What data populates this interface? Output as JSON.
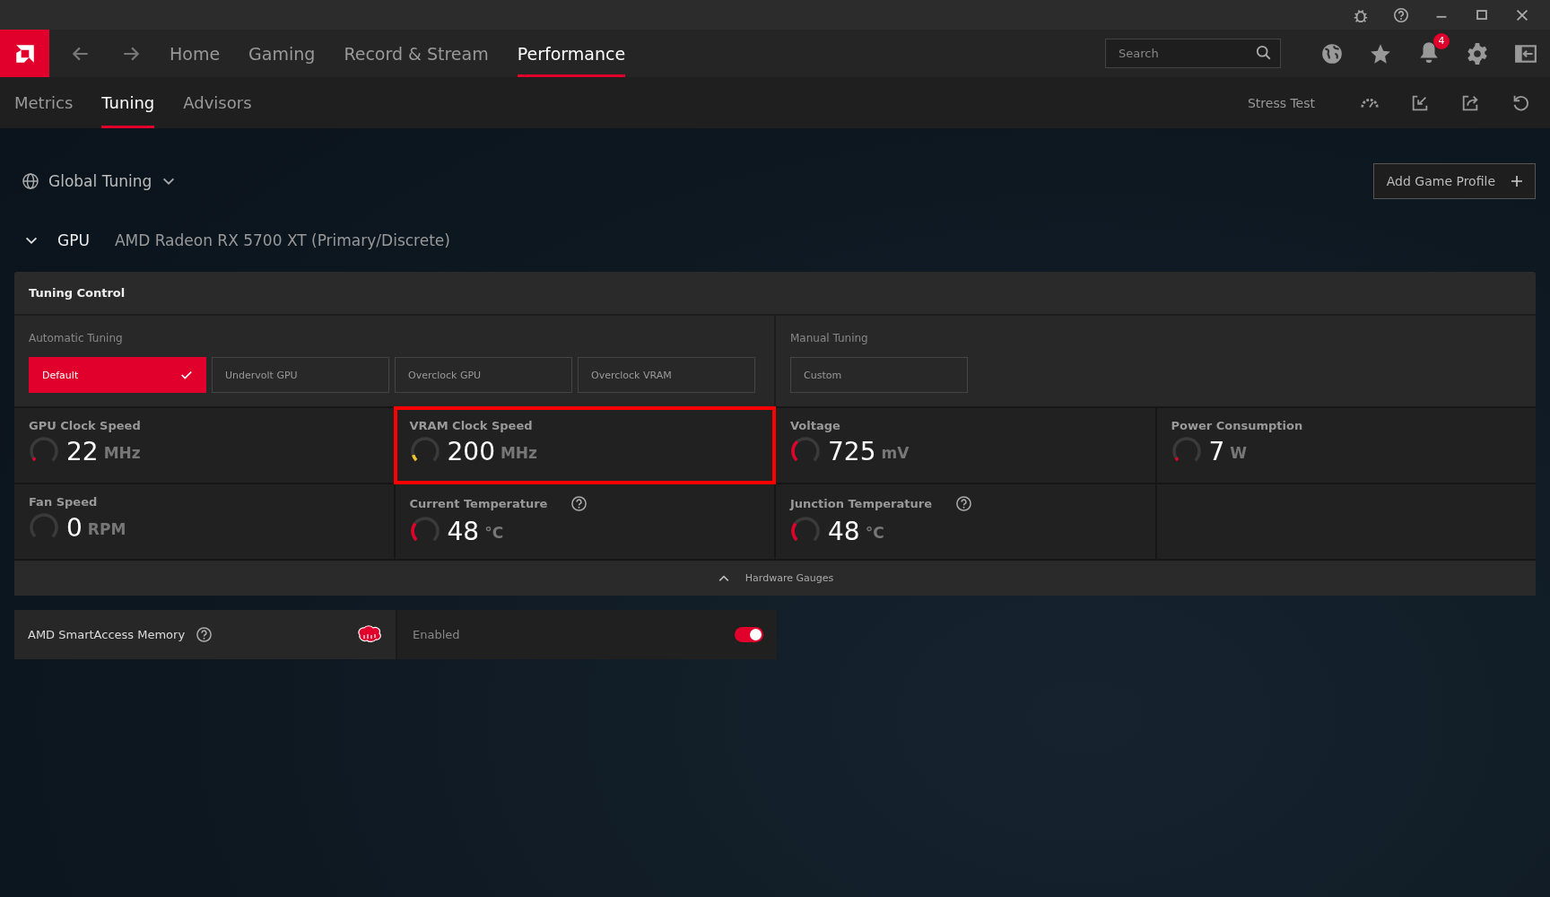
{
  "nav": {
    "tabs": [
      {
        "label": "Home",
        "selected": false
      },
      {
        "label": "Gaming",
        "selected": false
      },
      {
        "label": "Record & Stream",
        "selected": false
      },
      {
        "label": "Performance",
        "selected": true
      }
    ],
    "search": {
      "placeholder": "Search"
    },
    "notification_count": "4"
  },
  "subnav": {
    "tabs": [
      {
        "label": "Metrics",
        "selected": false
      },
      {
        "label": "Tuning",
        "selected": true
      },
      {
        "label": "Advisors",
        "selected": false
      }
    ],
    "stress_test": "Stress Test"
  },
  "profile": {
    "label": "Global Tuning",
    "add_button": "Add Game Profile"
  },
  "gpu": {
    "label": "GPU",
    "name": "AMD Radeon RX 5700 XT (Primary/Discrete)",
    "expanded": true
  },
  "tuning_control": {
    "title": "Tuning Control",
    "automatic": {
      "label": "Automatic Tuning",
      "options": [
        {
          "label": "Default",
          "selected": true
        },
        {
          "label": "Undervolt GPU",
          "selected": false
        },
        {
          "label": "Overclock GPU",
          "selected": false
        },
        {
          "label": "Overclock VRAM",
          "selected": false
        }
      ]
    },
    "manual": {
      "label": "Manual Tuning",
      "options": [
        {
          "label": "Custom",
          "selected": false
        }
      ]
    },
    "metrics": [
      {
        "label": "GPU Clock Speed",
        "value": "22",
        "unit": "MHz",
        "level": 0.05,
        "color": "#e0002b",
        "help": false,
        "highlighted": false
      },
      {
        "label": "VRAM Clock Speed",
        "value": "200",
        "unit": "MHz",
        "level": 0.1,
        "color": "#f2c12e",
        "help": false,
        "highlighted": true
      },
      {
        "label": "Voltage",
        "value": "725",
        "unit": "mV",
        "level": 0.35,
        "color": "#e0002b",
        "help": false,
        "highlighted": false
      },
      {
        "label": "Power Consumption",
        "value": "7",
        "unit": "W",
        "level": 0.05,
        "color": "#e0002b",
        "help": false,
        "highlighted": false
      },
      {
        "label": "Fan Speed",
        "value": "0",
        "unit": "RPM",
        "level": 0,
        "help": false,
        "highlighted": false
      },
      {
        "label": "Current Temperature",
        "value": "48",
        "unit": "°C",
        "level": 0.3,
        "color": "#e0002b",
        "help": true,
        "highlighted": false
      },
      {
        "label": "Junction Temperature",
        "value": "48",
        "unit": "°C",
        "level": 0.3,
        "color": "#e0002b",
        "help": true,
        "highlighted": false
      }
    ],
    "footer": "Hardware Gauges"
  },
  "smart_access": {
    "label": "AMD SmartAccess Memory",
    "status": "Enabled",
    "on": true
  }
}
